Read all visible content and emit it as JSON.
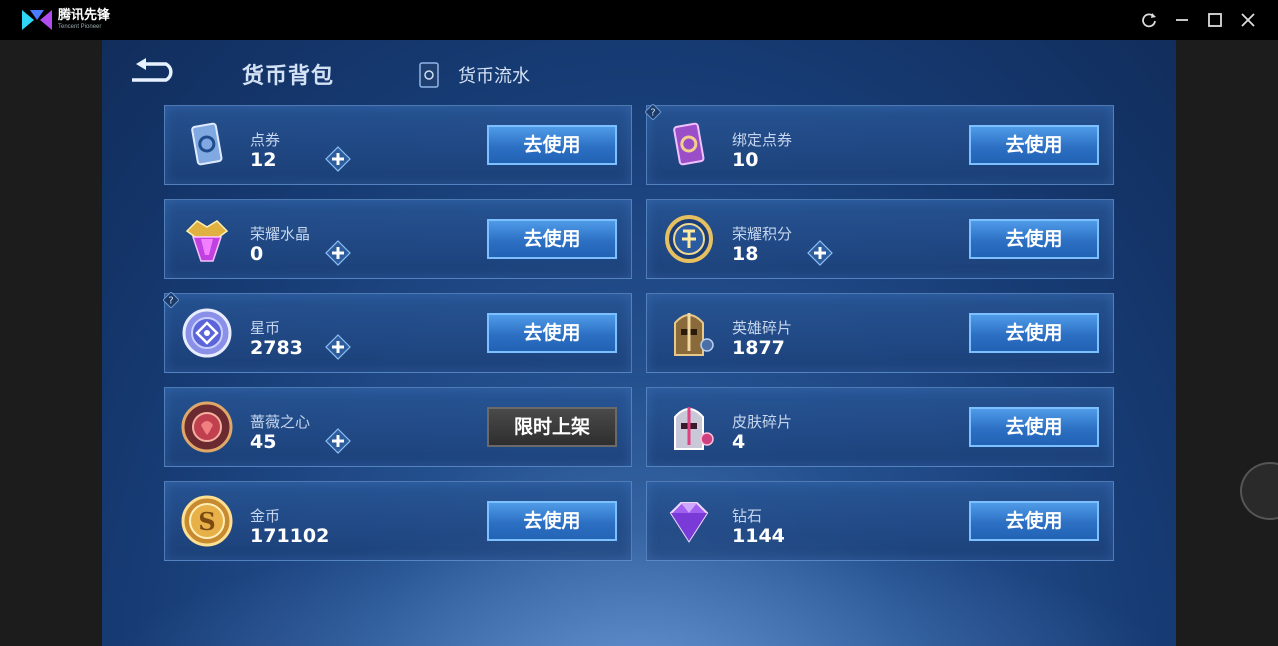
{
  "app": {
    "brand_name": "腾讯先锋",
    "brand_sub": "Tencent Pioneer",
    "window_controls": [
      "refresh-icon",
      "minimize-icon",
      "maximize-icon",
      "close-icon"
    ]
  },
  "header": {
    "title": "货币背包",
    "flow_link": "货币流水"
  },
  "colors": {
    "accent_button": "#2c70c4",
    "card_bg": "#24508f",
    "disabled_button": "#3a3a3a"
  },
  "currencies": [
    {
      "name": "点券",
      "value": "12",
      "button": "去使用",
      "icon": "voucher-icon",
      "has_plus": true
    },
    {
      "name": "绑定点券",
      "value": "10",
      "button": "去使用",
      "icon": "bound-voucher-icon",
      "has_plus": false,
      "has_help": true
    },
    {
      "name": "荣耀水晶",
      "value": "0",
      "button": "去使用",
      "icon": "glory-crystal-icon",
      "has_plus": true
    },
    {
      "name": "荣耀积分",
      "value": "18",
      "button": "去使用",
      "icon": "glory-points-icon",
      "has_plus": true
    },
    {
      "name": "星币",
      "value": "2783",
      "button": "去使用",
      "icon": "star-coin-icon",
      "has_plus": true,
      "has_help": true
    },
    {
      "name": "英雄碎片",
      "value": "1877",
      "button": "去使用",
      "icon": "hero-fragment-icon",
      "has_plus": false
    },
    {
      "name": "蔷薇之心",
      "value": "45",
      "button": "限时上架",
      "icon": "rose-heart-icon",
      "has_plus": true
    },
    {
      "name": "皮肤碎片",
      "value": "4",
      "button": "去使用",
      "icon": "skin-fragment-icon",
      "has_plus": false
    },
    {
      "name": "金币",
      "value": "171102",
      "button": "去使用",
      "icon": "gold-coin-icon",
      "has_plus": false
    },
    {
      "name": "钻石",
      "value": "1144",
      "button": "去使用",
      "icon": "diamond-icon",
      "has_plus": false
    }
  ]
}
